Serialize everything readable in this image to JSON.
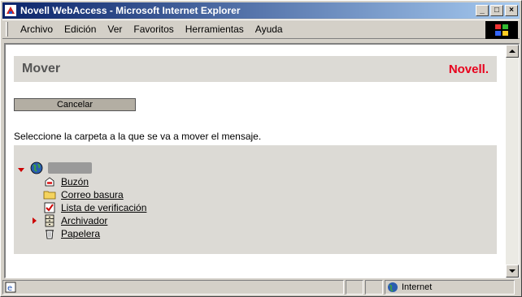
{
  "window": {
    "title": "Novell WebAccess - Microsoft Internet Explorer",
    "controls": {
      "minimize": "_",
      "maximize": "□",
      "close": "×"
    }
  },
  "menubar": {
    "items": [
      "Archivo",
      "Edición",
      "Ver",
      "Favoritos",
      "Herramientas",
      "Ayuda"
    ]
  },
  "page": {
    "title": "Mover",
    "brand": "Novell.",
    "cancel_label": "Cancelar",
    "instructions": "Seleccione la carpeta a la que se va a mover el mensaje.",
    "tree": {
      "root_expanded": true,
      "folders": [
        {
          "label": "Buzón",
          "icon": "mailbox-icon"
        },
        {
          "label": "Correo basura",
          "icon": "folder-icon"
        },
        {
          "label": "Lista de verificación",
          "icon": "checklist-icon"
        },
        {
          "label": "Archivador",
          "icon": "cabinet-icon",
          "collapsed": true
        },
        {
          "label": "Papelera",
          "icon": "trash-icon"
        }
      ]
    }
  },
  "statusbar": {
    "zone": "Internet"
  },
  "colors": {
    "titlebar_start": "#0a246a",
    "brand_red": "#e8001c",
    "panel_bg": "#dcdad5"
  }
}
